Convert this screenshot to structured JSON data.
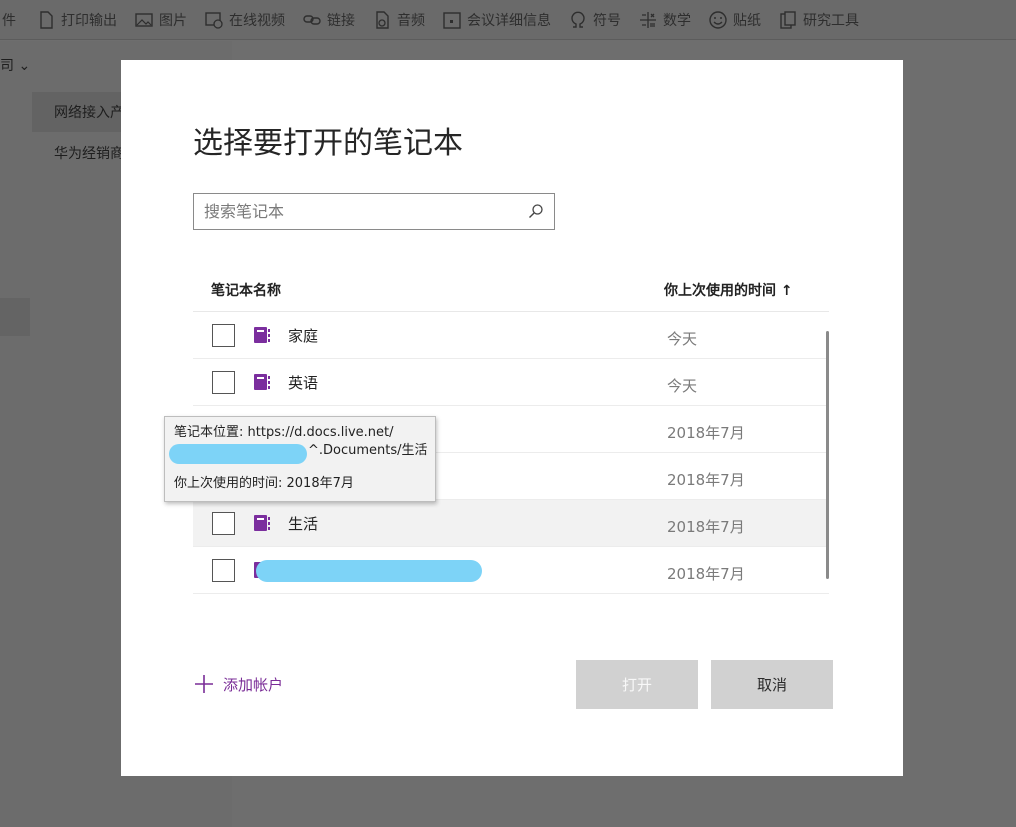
{
  "toolbar": {
    "items": [
      {
        "label": "件",
        "icon": "file-icon"
      },
      {
        "label": "打印输出",
        "icon": "printout-icon"
      },
      {
        "label": "图片",
        "icon": "picture-icon"
      },
      {
        "label": "在线视频",
        "icon": "online-video-icon"
      },
      {
        "label": "链接",
        "icon": "link-icon"
      },
      {
        "label": "音频",
        "icon": "audio-icon"
      },
      {
        "label": "会议详细信息",
        "icon": "meeting-details-icon"
      },
      {
        "label": "符号",
        "icon": "symbol-icon"
      },
      {
        "label": "数学",
        "icon": "math-icon"
      },
      {
        "label": "贴纸",
        "icon": "sticker-icon"
      },
      {
        "label": "研究工具",
        "icon": "research-tools-icon"
      }
    ]
  },
  "left_pane": {
    "header": "司 ⌄",
    "items": [
      {
        "label": "网络接入产"
      },
      {
        "label": "华为经销商"
      }
    ]
  },
  "dialog": {
    "title": "选择要打开的笔记本",
    "search_placeholder": "搜索笔记本",
    "columns": {
      "name": "笔记本名称",
      "last_used": "你上次使用的时间 ↑"
    },
    "notebooks": [
      {
        "name": "家庭",
        "time": "今天"
      },
      {
        "name": "英语",
        "time": "今天"
      },
      {
        "name": "",
        "time": "2018年7月"
      },
      {
        "name": "",
        "time": "2018年7月"
      },
      {
        "name": "生活",
        "time": "2018年7月"
      },
      {
        "name": "",
        "time": "2018年7月"
      }
    ],
    "add_account": "添加帐户",
    "open_button": "打开",
    "cancel_button": "取消"
  },
  "tooltip": {
    "location_line": "笔记本位置: https://d.docs.live.net/",
    "location_tail": "^.Documents/生活",
    "last_used_line": "你上次使用的时间: 2018年7月"
  },
  "colors": {
    "accent": "#7a2d97",
    "notebook_icon": "#7b2e9e",
    "redaction": "#7dd3f7"
  }
}
